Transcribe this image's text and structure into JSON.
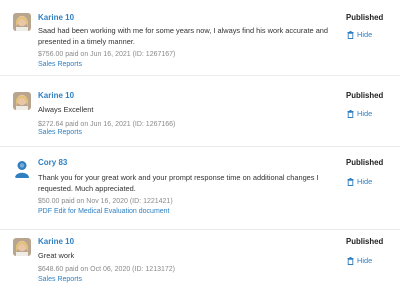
{
  "colors": {
    "link": "#2f7fc1",
    "meta": "#8a8a8a",
    "text": "#333333"
  },
  "reviews": [
    {
      "author": "Karine 10",
      "avatar": "photo-avatar",
      "text": "Saad had been working with me for some years now, I always find his work accurate and presented in a timely manner.",
      "meta": "$756.00 paid on Jun 16, 2021 (ID: 1267167)",
      "link": "Sales Reports",
      "status": "Published",
      "action": "Hide"
    },
    {
      "author": "Karine 10",
      "avatar": "photo-avatar",
      "text": "Always Excellent",
      "meta": "$272.64 paid on Jun 16, 2021 (ID: 1267166)",
      "link": "Sales Reports",
      "status": "Published",
      "action": "Hide"
    },
    {
      "author": "Cory 83",
      "avatar": "default-user-avatar",
      "text": "Thank you for your great work and your prompt response time on additional changes I requested. Much appreciated.",
      "meta": "$50.00 paid on Nov 16, 2020 (ID: 1221421)",
      "link": "PDF Edit for Medical Evaluation document",
      "status": "Published",
      "action": "Hide"
    },
    {
      "author": "Karine 10",
      "avatar": "photo-avatar",
      "text": "Great work",
      "meta": "$648.60 paid on Oct 06, 2020 (ID: 1213172)",
      "link": "Sales Reports",
      "status": "Published",
      "action": "Hide"
    }
  ]
}
